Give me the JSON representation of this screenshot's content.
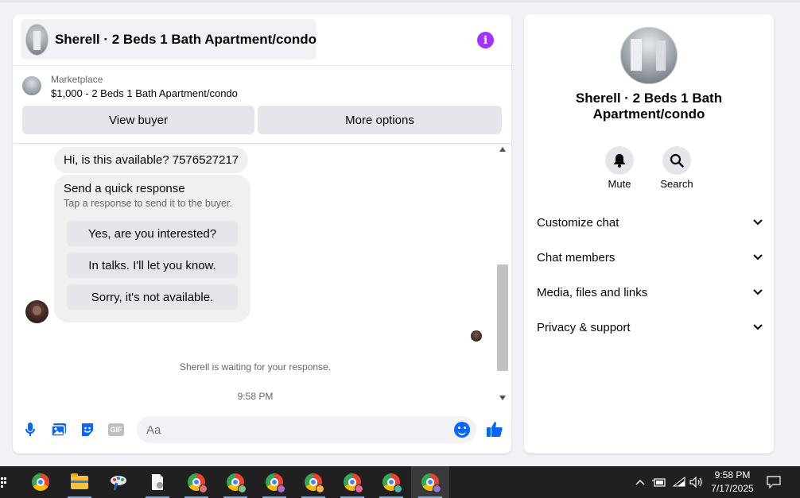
{
  "chat": {
    "title": "Sherell · 2 Beds 1 Bath Apartment/condo",
    "marketplace_label": "Marketplace",
    "listing": "$1,000 - 2 Beds 1 Bath Apartment/condo",
    "view_buyer": "View buyer",
    "more_options": "More options",
    "message": "Hi, is this available? 7576527217",
    "quick_response": {
      "title": "Send a quick response",
      "subtitle": "Tap a response to send it to the buyer.",
      "options": [
        "Yes, are you interested?",
        "In talks. I'll let you know.",
        "Sorry, it's not available."
      ]
    },
    "waiting": "Sherell is waiting for your response.",
    "time": "9:58 PM",
    "input_placeholder": "Aa"
  },
  "side": {
    "title": "Sherell · 2 Beds 1 Bath Apartment/condo",
    "actions": [
      {
        "label": "Mute",
        "icon": "bell-icon"
      },
      {
        "label": "Search",
        "icon": "search-icon"
      }
    ],
    "sections": [
      "Customize chat",
      "Chat members",
      "Media, files and links",
      "Privacy & support"
    ]
  },
  "taskbar": {
    "time": "9:58 PM",
    "date": "7/17/2025"
  },
  "colors": {
    "accent": "#0866ff",
    "info": "#a033ff",
    "button_bg": "#e4e6eb",
    "taskbar": "#202020"
  }
}
